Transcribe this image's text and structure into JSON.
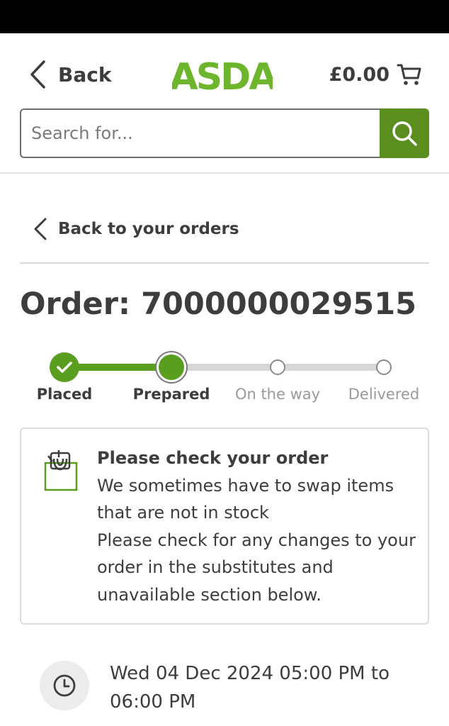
{
  "header": {
    "back_label": "Back",
    "logo_text": "ASDA",
    "cart_amount": "£0.00"
  },
  "search": {
    "placeholder": "Search for..."
  },
  "nav": {
    "back_to_orders_label": "Back to your orders"
  },
  "order": {
    "title": "Order: 7000000029515"
  },
  "tracker": {
    "progress_fraction": 0.333,
    "steps": [
      {
        "label": "Placed",
        "state": "done"
      },
      {
        "label": "Prepared",
        "state": "current"
      },
      {
        "label": "On the way",
        "state": "pending"
      },
      {
        "label": "Delivered",
        "state": "pending"
      }
    ]
  },
  "notice": {
    "heading": "Please check your order",
    "line1": "We sometimes have to swap items that are not in stock",
    "line2": "Please check for any changes to your order in the substitutes and unavailable section below.",
    "icon": "shopping-bag-icon"
  },
  "delivery": {
    "slot_text": "Wed 04 Dec 2024 05:00 PM to 06:00 PM",
    "icon": "clock-icon"
  },
  "colors": {
    "brand_green": "#5a9e1f",
    "search_button": "#5a8f1f",
    "logo_green": "#6cb52d",
    "text": "#3d3d3d"
  }
}
